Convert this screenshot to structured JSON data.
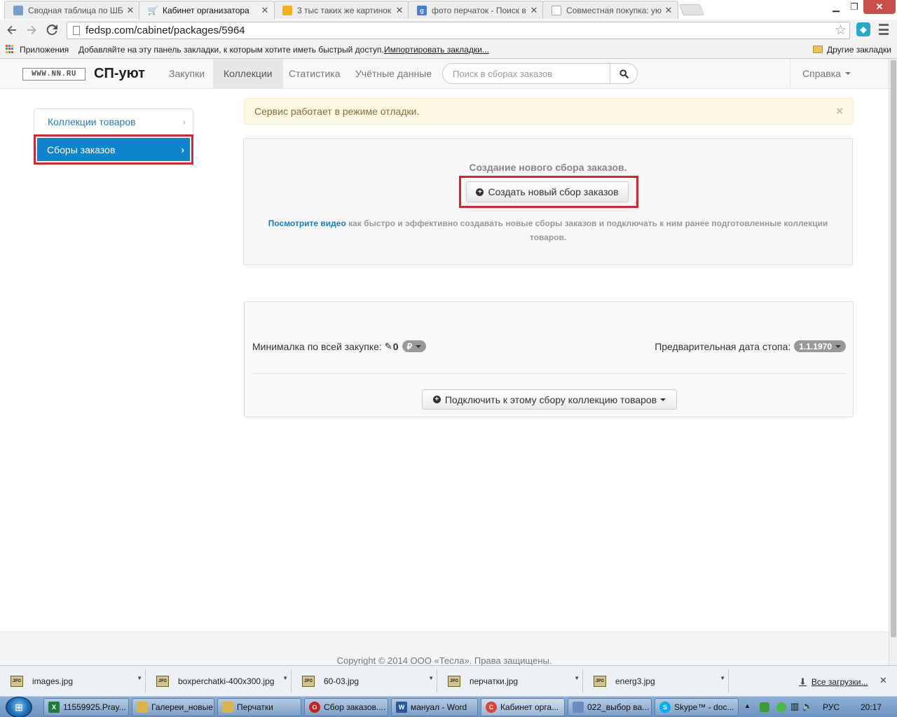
{
  "browser": {
    "tabs": [
      {
        "title": "Сводная таблица по ШБ",
        "icon": "spreadsheet-icon",
        "color": "#7a9ec9"
      },
      {
        "title": "Кабинет организатора",
        "icon": "cart-icon",
        "color": "#333333"
      },
      {
        "title": "3 тыс таких же картинок",
        "icon": "image-search-icon",
        "color": "#f2b01e"
      },
      {
        "title": "фото перчаток - Поиск в",
        "icon": "google-icon",
        "color": "#4a7bd8"
      },
      {
        "title": "Совместная покупка: ую",
        "icon": "page-icon",
        "color": "#c8c8c8"
      }
    ],
    "active_tab_index": 1,
    "url": "fedsp.com/cabinet/packages/5964",
    "bookmarks_bar": {
      "apps_label": "Приложения",
      "hint": "Добавляйте на эту панель закладки, к которым хотите иметь быстрый доступ.",
      "import_link": "Импортировать закладки...",
      "other_bookmarks": "Другие закладки"
    }
  },
  "site": {
    "logo_text": "WWW.NN.RU",
    "brand": "СП-уют",
    "nav": [
      {
        "label": "Закупки",
        "active": false
      },
      {
        "label": "Коллекции",
        "active": true
      },
      {
        "label": "Статистика",
        "active": false
      },
      {
        "label": "Учётные данные",
        "active": false
      }
    ],
    "search_placeholder": "Поиск в сборах заказов",
    "help_label": "Справка"
  },
  "sidebar": {
    "items": [
      {
        "label": "Коллекции товаров",
        "active": false
      },
      {
        "label": "Сборы заказов",
        "active": true
      }
    ]
  },
  "alert": {
    "text": "Сервис работает в режиме отладки.",
    "close": "×"
  },
  "create_panel": {
    "title": "Создание нового сбора заказов.",
    "button": "Создать новый сбор заказов",
    "video_link": "Посмотрите видео",
    "help_text": "как быстро и эффективно создавать новые сборы заказов и подключать к ним ранее подготовленные коллекции товаров."
  },
  "collection_panel": {
    "min_label": "Минималка по всей закупке:",
    "min_value": "0",
    "currency": "₽",
    "stop_label": "Предварительная дата стопа:",
    "stop_value": "1.1.1970",
    "attach_button": "Подключить к этому сбору коллекцию товаров"
  },
  "footer": {
    "copyright": "Copyright © 2014 ООО «Тесла». Права защищены."
  },
  "downloads": {
    "items": [
      "images.jpg",
      "boxperchatki-400x300.jpg",
      "60-03.jpg",
      "перчатки.jpg",
      "energ3.jpg"
    ],
    "file_badge": "JPG",
    "all_downloads": "Все загрузки..."
  },
  "taskbar": {
    "items": [
      {
        "label": "11559925.Pray...",
        "icon": "excel-icon",
        "color": "#1f7a3c",
        "letter": "X"
      },
      {
        "label": "Галереи_новые",
        "icon": "folder-icon",
        "color": "#d9b44a",
        "letter": ""
      },
      {
        "label": "Перчатки",
        "icon": "folder-icon",
        "color": "#d9b44a",
        "letter": ""
      },
      {
        "label": "Сбор заказов....",
        "icon": "opera-icon",
        "color": "#cc1e1e",
        "letter": "O"
      },
      {
        "label": "мануал - Word",
        "icon": "word-icon",
        "color": "#2b5797",
        "letter": "W"
      },
      {
        "label": "Кабинет орга...",
        "icon": "chrome-icon",
        "color": "#db4437",
        "letter": "C"
      },
      {
        "label": "022_выбор ва...",
        "icon": "viewer-icon",
        "color": "#6a8cc0",
        "letter": ""
      },
      {
        "label": "Skype™ - doc...",
        "icon": "skype-icon",
        "color": "#00aff0",
        "letter": "S"
      }
    ],
    "language": "РУС",
    "time": "20:17"
  }
}
